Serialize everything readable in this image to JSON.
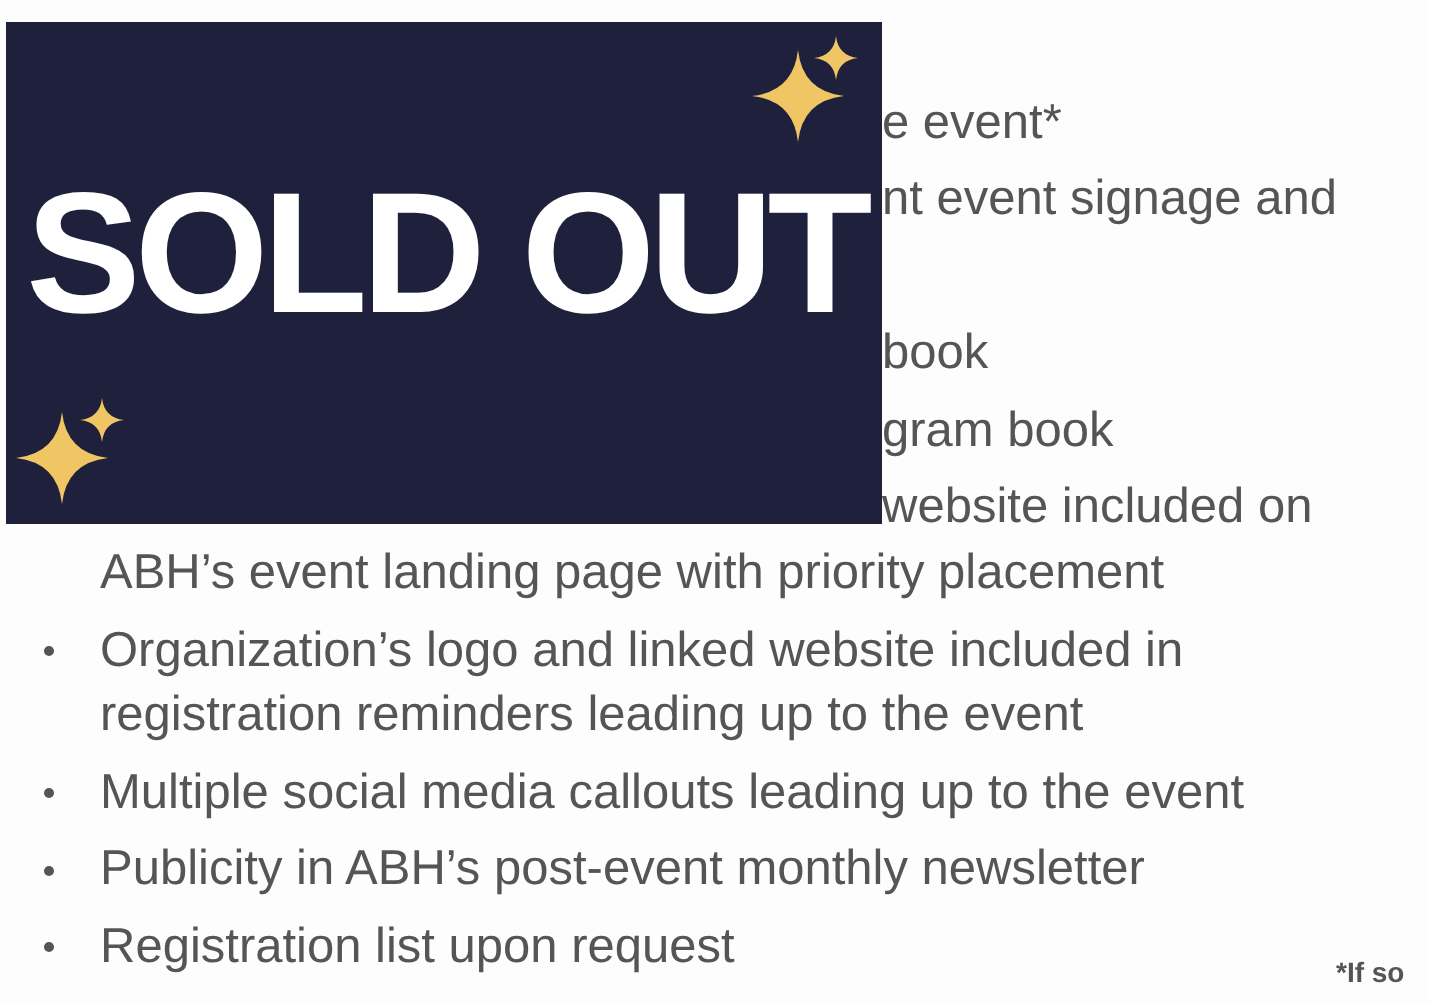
{
  "badge": {
    "text": "SOLD OUT"
  },
  "benefits": [
    {
      "kind": "covered",
      "lines": [
        "e event*"
      ]
    },
    {
      "kind": "covered_wrap",
      "lines": [
        "nt event signage and"
      ]
    },
    {
      "kind": "covered",
      "lines": [
        "book"
      ]
    },
    {
      "kind": "covered",
      "lines": [
        "gram book"
      ]
    },
    {
      "kind": "partly_covered",
      "lines": [
        "website included on",
        "ABH’s event landing page with priority placement"
      ]
    },
    {
      "kind": "full",
      "lines": [
        "Organization’s logo and linked website included in",
        "registration reminders leading up to the event"
      ]
    },
    {
      "kind": "full",
      "lines": [
        "Multiple social media callouts leading up to the event"
      ]
    },
    {
      "kind": "full",
      "lines": [
        "Publicity in ABH’s post-event monthly newsletter"
      ]
    },
    {
      "kind": "full",
      "lines": [
        "Registration list upon request"
      ]
    }
  ],
  "footnote": "*If so"
}
